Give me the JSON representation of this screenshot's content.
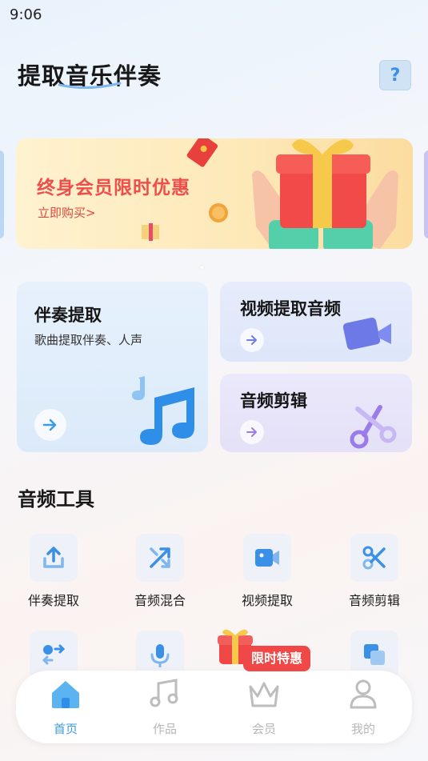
{
  "status": {
    "time": "9:06"
  },
  "header": {
    "title": "提取音乐伴奏",
    "help_label": "?"
  },
  "banner": {
    "title": "终身会员限时优惠",
    "link": "立即购买>"
  },
  "cards": {
    "accompaniment": {
      "title": "伴奏提取",
      "subtitle": "歌曲提取伴奏、人声"
    },
    "video": {
      "title": "视频提取音频"
    },
    "edit": {
      "title": "音频剪辑"
    }
  },
  "tools": {
    "title": "音频工具",
    "items": [
      {
        "label": "伴奏提取",
        "icon": "upload-icon"
      },
      {
        "label": "音频混合",
        "icon": "shuffle-icon"
      },
      {
        "label": "视频提取",
        "icon": "video-camera-icon"
      },
      {
        "label": "音频剪辑",
        "icon": "scissors-icon"
      }
    ]
  },
  "promo": {
    "label": "限时特惠"
  },
  "nav": {
    "items": [
      {
        "label": "首页",
        "icon": "home-icon",
        "active": true
      },
      {
        "label": "作品",
        "icon": "music-note-icon"
      },
      {
        "label": "会员",
        "icon": "crown-icon"
      },
      {
        "label": "我的",
        "icon": "user-icon"
      }
    ]
  },
  "colors": {
    "accent": "#3a9ee6",
    "banner_red": "#ee4f4c",
    "promo_red": "#f04747"
  }
}
